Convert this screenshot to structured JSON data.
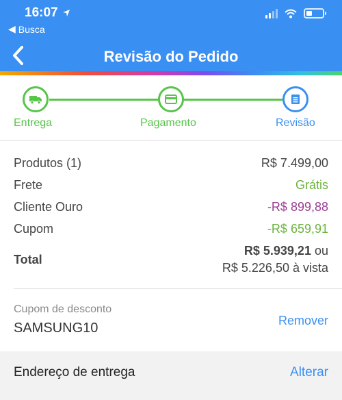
{
  "status_bar": {
    "time": "16:07",
    "back_app": "Busca"
  },
  "header": {
    "title": "Revisão do Pedido"
  },
  "stepper": {
    "steps": [
      {
        "label": "Entrega"
      },
      {
        "label": "Pagamento"
      },
      {
        "label": "Revisão"
      }
    ]
  },
  "summary": {
    "products_label": "Produtos (1)",
    "products_value": "R$ 7.499,00",
    "shipping_label": "Frete",
    "shipping_value": "Grátis",
    "gold_label": "Cliente Ouro",
    "gold_value": "-R$ 899,88",
    "coupon_label": "Cupom",
    "coupon_value": "-R$ 659,91",
    "total_label": "Total",
    "total_value": "R$ 5.939,21",
    "total_or": "ou",
    "total_cash": "R$ 5.226,50 à vista"
  },
  "coupon": {
    "label": "Cupom de desconto",
    "code": "SAMSUNG10",
    "action": "Remover"
  },
  "address": {
    "title": "Endereço de entrega",
    "action": "Alterar"
  },
  "colors": {
    "primary": "#3a8ff2",
    "success": "#57c44a",
    "discount_gold": "#9b3f93"
  }
}
